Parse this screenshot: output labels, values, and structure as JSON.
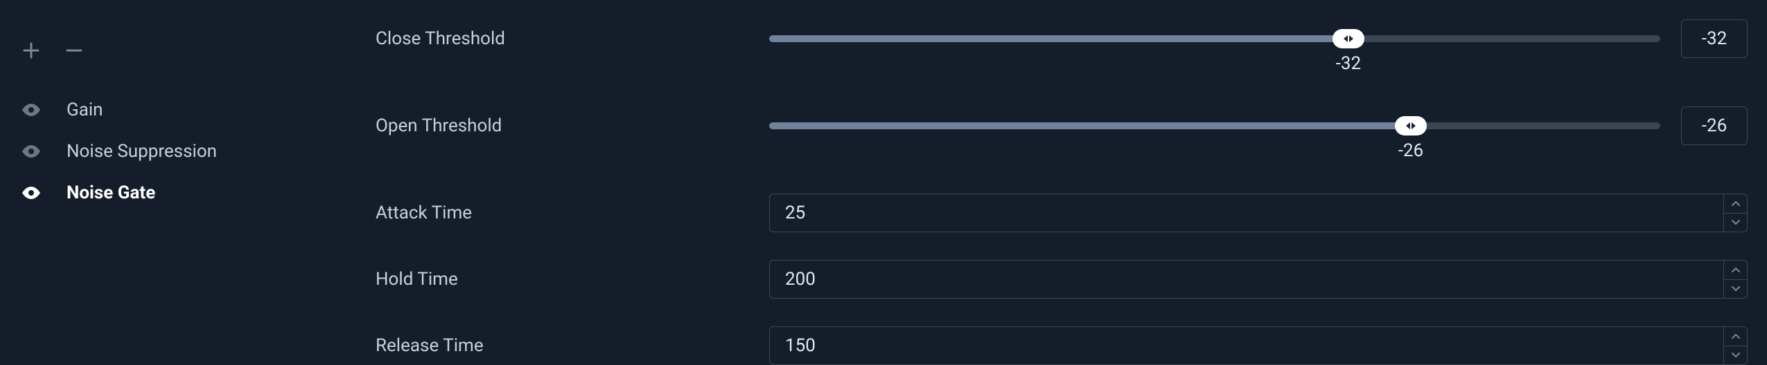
{
  "sidebar": {
    "filters": [
      {
        "label": "Gain",
        "active": false
      },
      {
        "label": "Noise Suppression",
        "active": false
      },
      {
        "label": "Noise Gate",
        "active": true
      }
    ]
  },
  "settings": {
    "close_threshold": {
      "label": "Close Threshold",
      "value": "-32",
      "value_below": "-32",
      "fill_percent": 65
    },
    "open_threshold": {
      "label": "Open Threshold",
      "value": "-26",
      "value_below": "-26",
      "fill_percent": 72
    },
    "attack_time": {
      "label": "Attack Time",
      "value": "25"
    },
    "hold_time": {
      "label": "Hold Time",
      "value": "200"
    },
    "release_time": {
      "label": "Release Time",
      "value": "150"
    }
  }
}
